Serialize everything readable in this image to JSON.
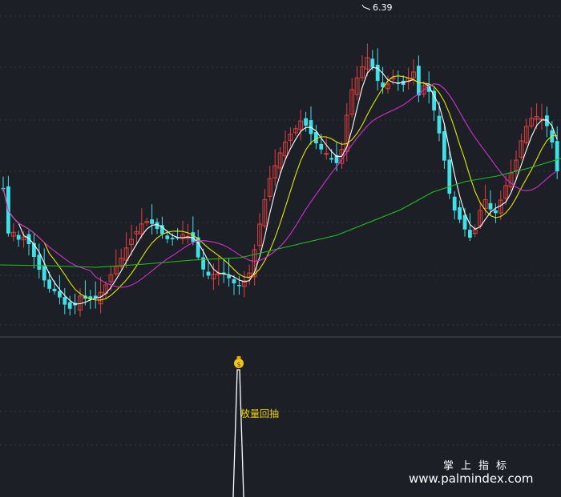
{
  "chart_data": {
    "type": "candlestick",
    "colors": {
      "background": "#1c1f26",
      "grid": "#2f3440",
      "separator": "#4a4f5c",
      "up": "#e0403c",
      "down": "#3fe0e8",
      "ma_white": "#ffffff",
      "ma_yellow": "#e6e600",
      "ma_magenta": "#d030d0",
      "ma_green": "#20c020"
    },
    "peak_label": "6.39",
    "signal_label": "放量回抽",
    "signal_icon": "money-bag-icon",
    "watermark": {
      "line1": "掌上指标",
      "line2": "www.palmindex.com"
    }
  }
}
